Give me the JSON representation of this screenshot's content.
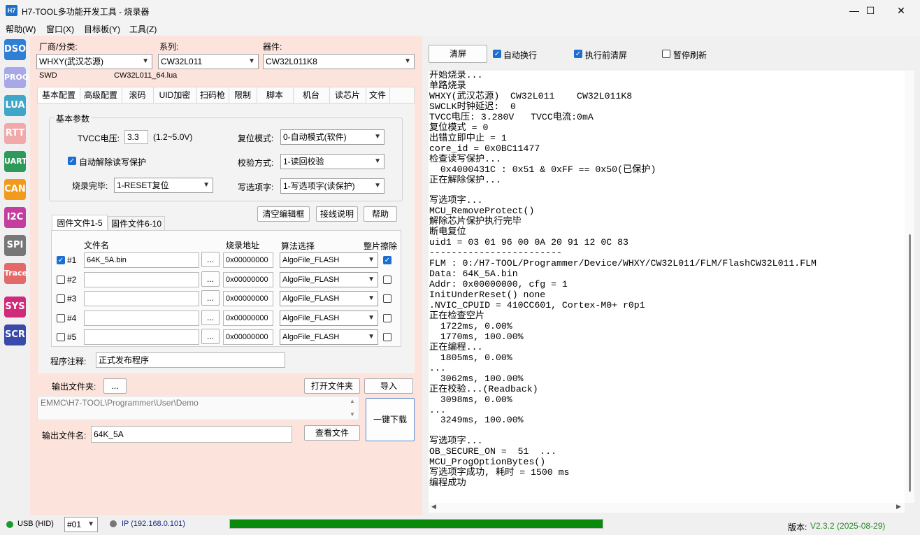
{
  "window": {
    "title": "H7-TOOL多功能开发工具 - 烧录器",
    "icon_text": "H7",
    "minimize": "—",
    "maximize": "☐",
    "close": "✕"
  },
  "menu": [
    "帮助(W)",
    "窗口(X)",
    "目标板(Y)",
    "工具(Z)"
  ],
  "toolbar": [
    {
      "label": "DSO",
      "color": "#2f7fd6"
    },
    {
      "label": "PROG",
      "color": "#a8a8e8"
    },
    {
      "label": "LUA",
      "color": "#3fa6c8"
    },
    {
      "label": "RTT",
      "color": "#f2a9a9"
    },
    {
      "label": "UART",
      "color": "#2e9a5a"
    },
    {
      "label": "CAN",
      "color": "#f29a1e"
    },
    {
      "label": "I2C",
      "color": "#c43ea0"
    },
    {
      "label": "SPI",
      "color": "#777777"
    },
    {
      "label": "Trace",
      "color": "#e46a6a"
    },
    {
      "label": "SYS",
      "color": "#d02a7a"
    },
    {
      "label": "SCR",
      "color": "#3a4aa8"
    }
  ],
  "selectors": {
    "vendor_label": "厂商/分类:",
    "vendor_value": "WHXY(武汉芯源)",
    "series_label": "系列:",
    "series_value": "CW32L011",
    "device_label": "器件:",
    "device_value": "CW32L011K8"
  },
  "info": {
    "interface": "SWD",
    "lua_file": "CW32L011_64.lua"
  },
  "tabs": [
    "基本配置",
    "高级配置",
    "滚码",
    "UID加密",
    "扫码枪",
    "限制",
    "脚本",
    "机台",
    "读芯片",
    "文件"
  ],
  "basic": {
    "group_title": "基本参数",
    "tvcc_label": "TVCC电压:",
    "tvcc_value": "3.3",
    "tvcc_range": "(1.2~5.0V)",
    "reset_mode_label": "复位模式:",
    "reset_mode_value": "0-自动模式(软件)",
    "auto_unprotect_label": "自动解除读写保护",
    "auto_unprotect_checked": true,
    "verify_label": "校验方式:",
    "verify_value": "1-读回校验",
    "finish_label": "烧录完毕:",
    "finish_value": "1-RESET复位",
    "option_label": "写选项字:",
    "option_value": "1-写选项字(读保护)"
  },
  "buttons": {
    "clear_edit": "清空编辑框",
    "wiring": "接线说明",
    "help": "帮助",
    "open_folder": "打开文件夹",
    "import": "导入",
    "one_click_download": "一键下载",
    "view_file": "查看文件",
    "browse": "...",
    "clear_screen": "清屏"
  },
  "file_tabs": [
    "固件文件1-5",
    "固件文件6-10"
  ],
  "file_table": {
    "headers": {
      "name": "文件名",
      "addr": "烧录地址",
      "algo": "算法选择",
      "erase": "整片擦除"
    },
    "rows": [
      {
        "id": "#1",
        "checked": true,
        "file": "64K_5A.bin",
        "addr": "0x00000000",
        "algo": "AlgoFile_FLASH",
        "erase": true
      },
      {
        "id": "#2",
        "checked": false,
        "file": "",
        "addr": "0x00000000",
        "algo": "AlgoFile_FLASH",
        "erase": false
      },
      {
        "id": "#3",
        "checked": false,
        "file": "",
        "addr": "0x00000000",
        "algo": "AlgoFile_FLASH",
        "erase": false
      },
      {
        "id": "#4",
        "checked": false,
        "file": "",
        "addr": "0x00000000",
        "algo": "AlgoFile_FLASH",
        "erase": false
      },
      {
        "id": "#5",
        "checked": false,
        "file": "",
        "addr": "0x00000000",
        "algo": "AlgoFile_FLASH",
        "erase": false
      }
    ]
  },
  "notes": {
    "label": "程序注释:",
    "value": "正式发布程序"
  },
  "output": {
    "folder_label": "输出文件夹:",
    "folder_path": "EMMC\\H7-TOOL\\Programmer\\User\\Demo",
    "filename_label": "输出文件名:",
    "filename_value": "64K_5A"
  },
  "log_options": {
    "auto_wrap": "自动换行",
    "auto_wrap_checked": true,
    "clear_before_run": "执行前清屏",
    "clear_before_run_checked": true,
    "pause_refresh": "暂停刷新",
    "pause_refresh_checked": false
  },
  "log_lines": [
    "开始烧录...",
    "单路烧录",
    "WHXY(武汉芯源)  CW32L011    CW32L011K8",
    "SWCLK时钟延迟:  0",
    "TVCC电压: 3.280V   TVCC电流:0mA",
    "复位模式 = 0",
    "出错立即中止 = 1",
    "core_id = 0x0BC11477",
    "检查读写保护...",
    "  0x4000431C : 0x51 & 0xFF == 0x50(已保护)",
    "正在解除保护...",
    "",
    "写选项字...",
    "MCU_RemoveProtect()",
    "解除芯片保护执行完毕",
    "断电复位",
    "uid1 = 03 01 96 00 0A 20 91 12 0C 83",
    "------------------------",
    "FLM : 0:/H7-TOOL/Programmer/Device/WHXY/CW32L011/FLM/FlashCW32L011.FLM",
    "Data: 64K_5A.bin",
    "Addr: 0x00000000, cfg = 1",
    "InitUnderReset() none",
    ".NVIC_CPUID = 410CC601, Cortex-M0+ r0p1",
    "正在检查空片",
    "  1722ms, 0.00%",
    "  1770ms, 100.00%",
    "正在编程...",
    "  1805ms, 0.00%",
    "...",
    "  3062ms, 100.00%",
    "正在校验...(Readback)",
    "  3098ms, 0.00%",
    "...",
    "  3249ms, 100.00%",
    "",
    "写选项字...",
    "OB_SECURE_ON =  51  ...",
    "MCU_ProgOptionBytes()",
    "写选项字成功, 耗时 = 1500 ms",
    "编程成功"
  ],
  "status": {
    "usb_label": "USB (HID)",
    "usb_color": "#1a9a2a",
    "channel": "#01",
    "ip_label": "IP (192.168.0.101)",
    "progress": 1.0,
    "progress_color": "#0a8a0a",
    "version_label": "版本:",
    "version_value": "V2.3.2 (2025-08-29)",
    "version_color": "#2a8a2a"
  }
}
